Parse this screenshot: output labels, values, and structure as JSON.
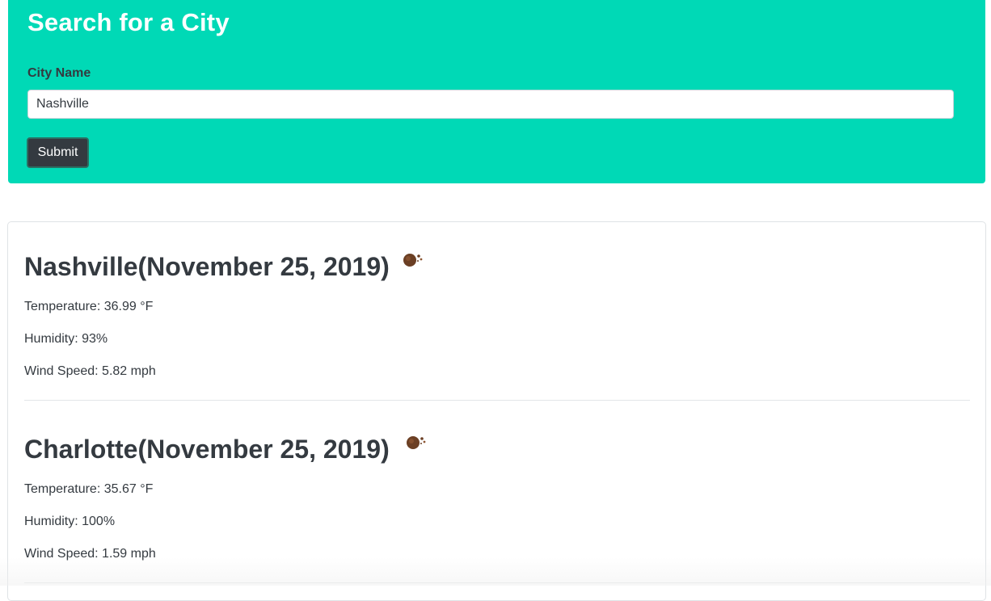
{
  "search": {
    "title": "Search for a City",
    "label": "City Name",
    "value": "Nashville",
    "button": "Submit"
  },
  "colors": {
    "panel": "#00d9b6",
    "button": "#343a40",
    "text": "#343a40"
  },
  "results": [
    {
      "title": "Nashville(November 25, 2019)",
      "icon": "cloud-weather-icon",
      "temperature": "Temperature: 36.99 °F",
      "humidity": "Humidity: 93%",
      "wind": "Wind Speed: 5.82 mph"
    },
    {
      "title": "Charlotte(November 25, 2019)",
      "icon": "cloud-weather-icon",
      "temperature": "Temperature: 35.67 °F",
      "humidity": "Humidity: 100%",
      "wind": "Wind Speed: 1.59 mph"
    }
  ]
}
